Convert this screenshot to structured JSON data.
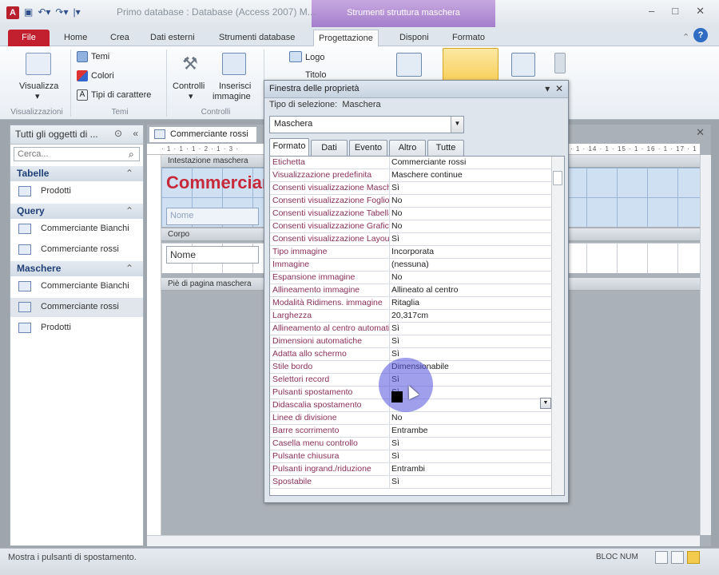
{
  "window": {
    "app_icon": "A",
    "title": "Primo database : Database (Access 2007) M...",
    "context_band": "Strumenti struttura maschera",
    "controls": [
      "–",
      "□",
      "✕"
    ]
  },
  "ribbon_tabs": [
    "File",
    "Home",
    "Crea",
    "Dati esterni",
    "Strumenti database",
    "Progettazione",
    "Disponi",
    "Formato"
  ],
  "ribbon": {
    "visualizza": "Visualizza",
    "temi": "Temi",
    "colori": "Colori",
    "tipi_carattere": "Tipi di carattere",
    "controlli": "Controlli",
    "inserisci_immagine_1": "Inserisci",
    "inserisci_immagine_2": "immagine",
    "logo": "Logo",
    "titolo": "Titolo",
    "group_visualizzazioni": "Visualizzazioni",
    "group_temi": "Temi",
    "group_controlli": "Controlli"
  },
  "nav": {
    "header": "Tutti gli oggetti di ...",
    "search_placeholder": "Cerca...",
    "sections": [
      {
        "title": "Tabelle",
        "items": [
          "Prodotti"
        ]
      },
      {
        "title": "Query",
        "items": [
          "Commerciante Bianchi",
          "Commerciante rossi"
        ]
      },
      {
        "title": "Maschere",
        "items": [
          "Commerciante Bianchi",
          "Commerciante rossi",
          "Prodotti"
        ]
      }
    ]
  },
  "document": {
    "tab": "Commerciante rossi",
    "ruler": "· 1 · 1 · 1 · 2 · 1 · 3 ·",
    "ruler_right": "· 1 · 14 · 1 · 15 · 1 · 16 · 1 · 17 · 1",
    "section_header": "Intestazione maschera",
    "section_body": "Corpo",
    "section_footer": "Piè di pagina maschera",
    "header_title": "Commerciante rossi",
    "header_field": "Nome",
    "body_field": "Nome"
  },
  "property_sheet": {
    "title": "Finestra delle proprietà",
    "selection_label": "Tipo di selezione:",
    "selection_type": "Maschera",
    "object": "Maschera",
    "tabs": [
      "Formato",
      "Dati",
      "Evento",
      "Altro",
      "Tutte"
    ],
    "properties": [
      [
        "Etichetta",
        "Commerciante rossi"
      ],
      [
        "Visualizzazione predefinita",
        "Maschere continue"
      ],
      [
        "Consenti visualizzazione Maschera",
        "Sì"
      ],
      [
        "Consenti visualizzazione Foglio dati",
        "No"
      ],
      [
        "Consenti visualizzazione Tabella pivot",
        "No"
      ],
      [
        "Consenti visualizzazione Grafico pivot",
        "No"
      ],
      [
        "Consenti visualizzazione Layout",
        "Sì"
      ],
      [
        "Tipo immagine",
        "Incorporata"
      ],
      [
        "Immagine",
        "(nessuna)"
      ],
      [
        "Espansione immagine",
        "No"
      ],
      [
        "Allineamento immagine",
        "Allineato al centro"
      ],
      [
        "Modalità Ridimens. immagine",
        "Ritaglia"
      ],
      [
        "Larghezza",
        "20,317cm"
      ],
      [
        "Allineamento al centro automatico",
        "Sì"
      ],
      [
        "Dimensioni automatiche",
        "Sì"
      ],
      [
        "Adatta allo schermo",
        "Sì"
      ],
      [
        "Stile bordo",
        "Dimensionabile"
      ],
      [
        "Selettori record",
        "Sì"
      ],
      [
        "Pulsanti spostamento",
        "Sì"
      ],
      [
        "Didascalia spostamento",
        ""
      ],
      [
        "Linee di divisione",
        "No"
      ],
      [
        "Barre scorrimento",
        "Entrambe"
      ],
      [
        "Casella menu controllo",
        "Sì"
      ],
      [
        "Pulsante chiusura",
        "Sì"
      ],
      [
        "Pulsanti ingrand./riduzione",
        "Entrambi"
      ],
      [
        "Spostabile",
        "Sì"
      ]
    ]
  },
  "status": {
    "message": "Mostra i pulsanti di spostamento.",
    "num": "BLOC NUM"
  }
}
